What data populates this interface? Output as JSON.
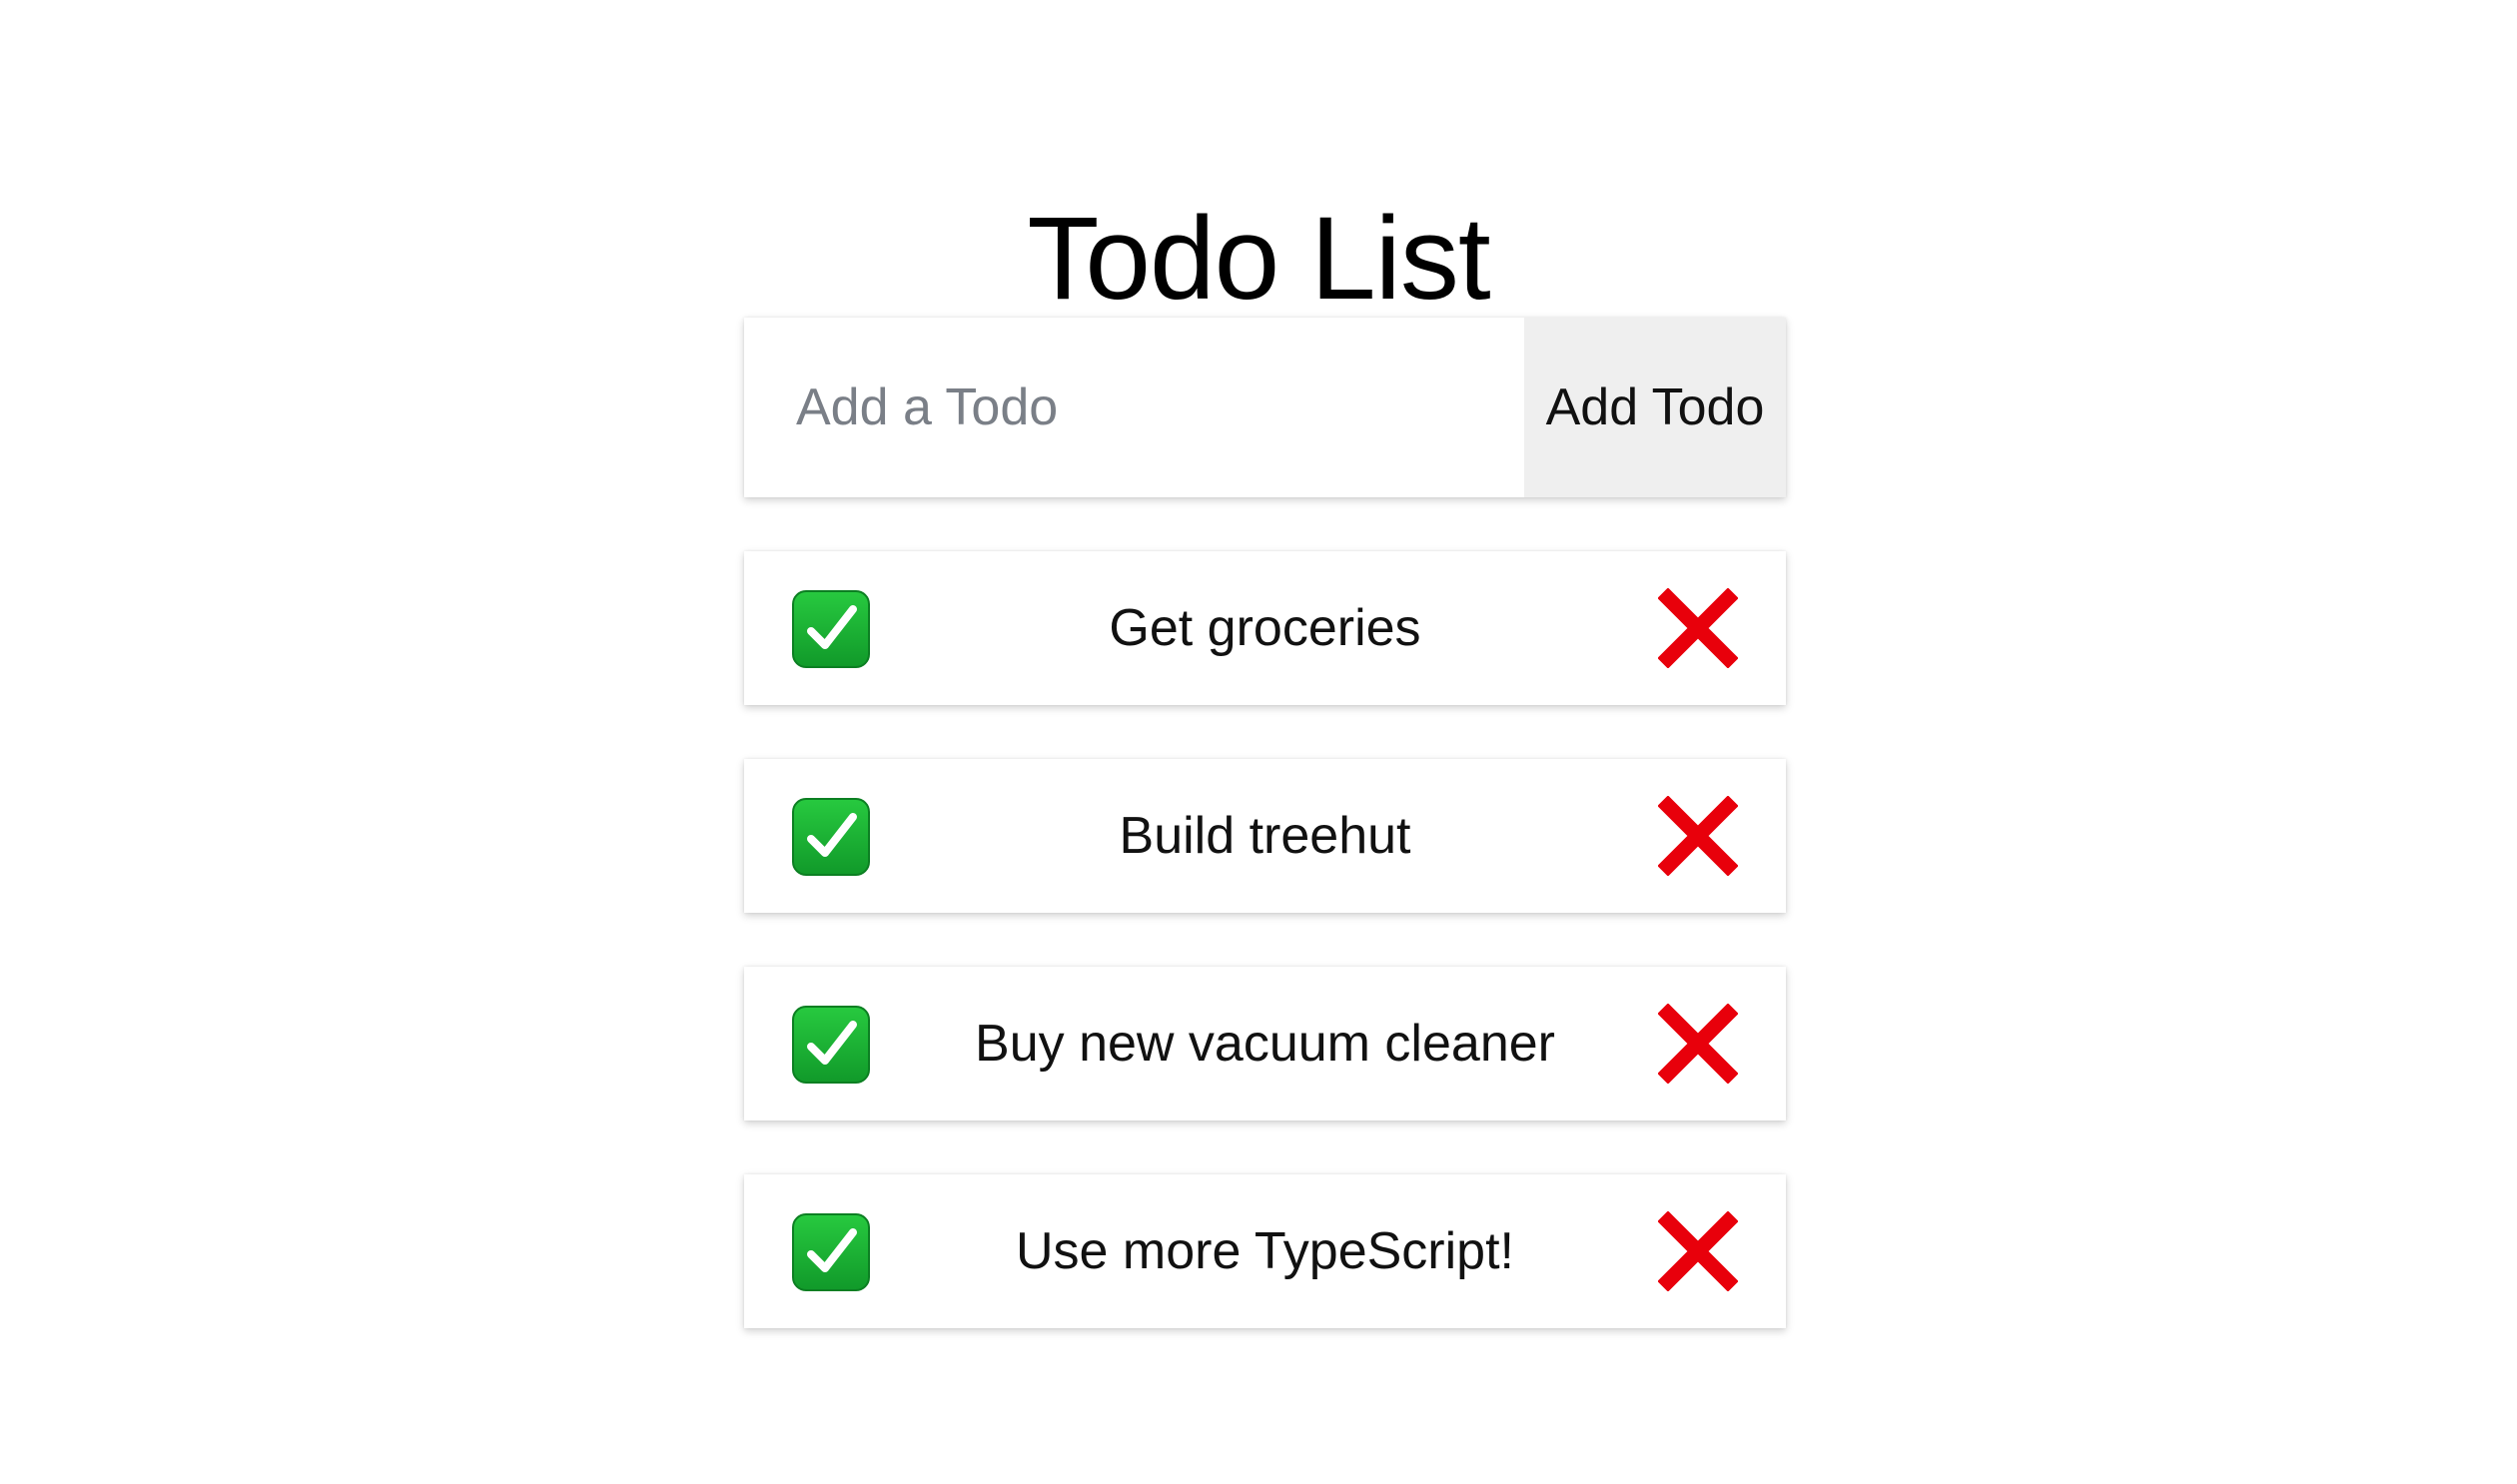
{
  "page": {
    "title": "Todo List"
  },
  "form": {
    "input_placeholder": "Add a Todo",
    "input_value": "",
    "add_label": "Add Todo"
  },
  "todos": [
    {
      "text": "Get groceries"
    },
    {
      "text": "Build treehut"
    },
    {
      "text": "Buy new vacuum cleaner"
    },
    {
      "text": "Use more TypeScript!"
    }
  ],
  "icons": {
    "complete": "check-mark-button-icon",
    "delete": "cross-mark-icon"
  },
  "colors": {
    "check_green": "#18b633",
    "delete_red": "#e8000b",
    "button_bg": "#efefef",
    "placeholder": "#7a7f87"
  }
}
